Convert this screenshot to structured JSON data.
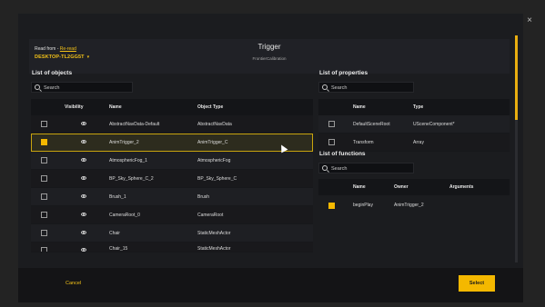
{
  "header": {
    "read_from_label": "Read from -",
    "reread_link": "Re-read",
    "device": "DESKTOP-TL2GG5T",
    "device_caret": "▾",
    "title": "Trigger",
    "subtitle": "FrontierCalibration"
  },
  "close_symbol": "×",
  "objects": {
    "title": "List of objects",
    "search_placeholder": "Search",
    "columns": {
      "visibility": "Visibility",
      "name": "Name",
      "type": "Object Type"
    },
    "rows": [
      {
        "name": "AbstractNavData-Default",
        "type": "AbstractNavData",
        "checked": false
      },
      {
        "name": "AnimTrigger_2",
        "type": "AnimTrigger_C",
        "checked": true
      },
      {
        "name": "AtmosphericFog_1",
        "type": "AtmosphericFog",
        "checked": false
      },
      {
        "name": "BP_Sky_Sphere_C_2",
        "type": "BP_Sky_Sphere_C",
        "checked": false
      },
      {
        "name": "Brush_1",
        "type": "Brush",
        "checked": false
      },
      {
        "name": "CameraRoot_0",
        "type": "CameraRoot",
        "checked": false
      },
      {
        "name": "Chair",
        "type": "StaticMeshActor",
        "checked": false
      },
      {
        "name": "Chair_15",
        "type": "StaticMeshActor",
        "checked": false
      }
    ]
  },
  "properties": {
    "title": "List of properties",
    "search_placeholder": "Search",
    "columns": {
      "name": "Name",
      "type": "Type"
    },
    "rows": [
      {
        "name": "DefaultSceneRoot",
        "type": "USceneComponent*",
        "checked": false
      },
      {
        "name": "Transform",
        "type": "Array",
        "checked": false
      }
    ]
  },
  "functions": {
    "title": "List of functions",
    "search_placeholder": "Search",
    "columns": {
      "name": "Name",
      "owner": "Owner",
      "arguments": "Arguments"
    },
    "rows": [
      {
        "name": "beginPlay",
        "owner": "AnimTrigger_2",
        "arguments": "",
        "checked": true
      }
    ]
  },
  "footer": {
    "cancel": "Cancel",
    "select": "Select"
  },
  "colors": {
    "accent": "#f4b800",
    "selected_border": "#c9a40e"
  }
}
